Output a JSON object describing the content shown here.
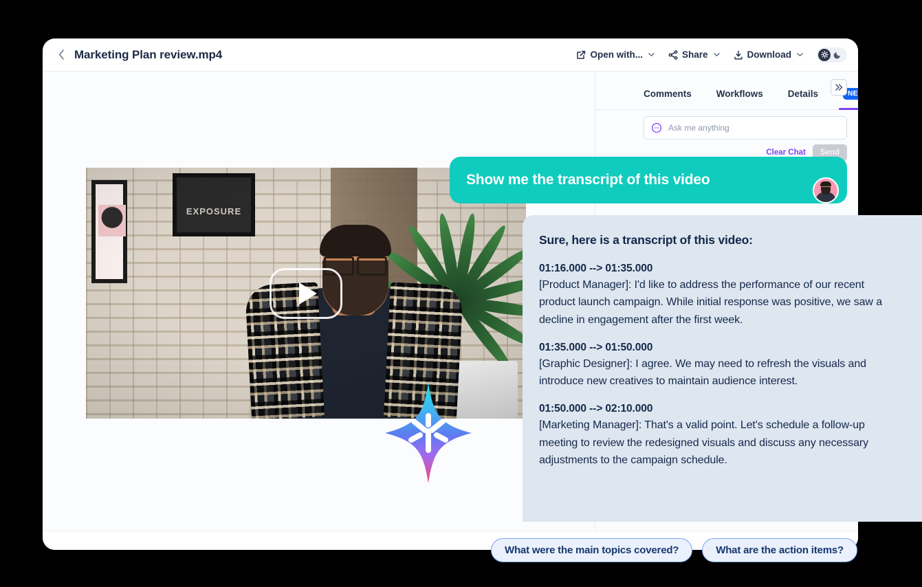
{
  "header": {
    "back_icon": "chevron-left-icon",
    "title": "Marketing Plan review.mp4",
    "actions": [
      {
        "label": "Open with...",
        "icon": "external-link-icon",
        "caret": "⌄"
      },
      {
        "label": "Share",
        "icon": "share-icon",
        "caret": "⌄"
      },
      {
        "label": "Download",
        "icon": "download-icon",
        "caret": "⌄"
      }
    ],
    "theme_toggle": {
      "light_icon": "sun-icon",
      "dark_icon": "moon-icon",
      "state": "light"
    }
  },
  "video": {
    "play_label": "play-button",
    "scene_description": "Man with glasses and beard in plaid shirt in front of brick wall"
  },
  "right_panel": {
    "tabs": [
      {
        "label": "Comments",
        "active": false
      },
      {
        "label": "Workflows",
        "active": false
      },
      {
        "label": "Details",
        "active": false
      },
      {
        "label": "NEW",
        "active": true,
        "is_badge": true
      }
    ],
    "collapse_icon": "chevrons-right-icon",
    "chat_input": {
      "icon": "chat-bubble-icon",
      "placeholder": "Ask me anything",
      "value": ""
    },
    "clear_chat_label": "Clear Chat",
    "send_label": "Send"
  },
  "conversation": {
    "user_message": "Show me the transcript of this video",
    "avatar": "user-avatar",
    "ai_icon": "ai-sparkle-star-icon",
    "response": {
      "title": "Sure, here is a transcript of this video:",
      "segments": [
        {
          "time": "01:16.000 --> 01:35.000",
          "text": "[Product Manager]: I'd like to address the performance of our recent product launch campaign. While initial response was positive, we saw a decline in engagement after the first week."
        },
        {
          "time": "01:35.000 --> 01:50.000",
          "text": "[Graphic Designer]: I agree. We may need to refresh the visuals and introduce new creatives to maintain audience interest."
        },
        {
          "time": "01:50.000 --> 02:10.000",
          "text": "[Marketing Manager]: That's a valid point. Let's schedule a follow-up meeting to review the redesigned visuals and discuss any necessary adjustments to the campaign schedule."
        }
      ]
    }
  },
  "suggestions": [
    "What were the main topics covered?",
    "What are the action items?"
  ],
  "colors": {
    "user_bubble": "#0fccbe",
    "response_bg": "#dee6f0",
    "accent_purple": "#7b42f6",
    "badge_blue": "#1265f5",
    "chip_border": "#7ba4ef",
    "text_dark": "#14284a"
  }
}
